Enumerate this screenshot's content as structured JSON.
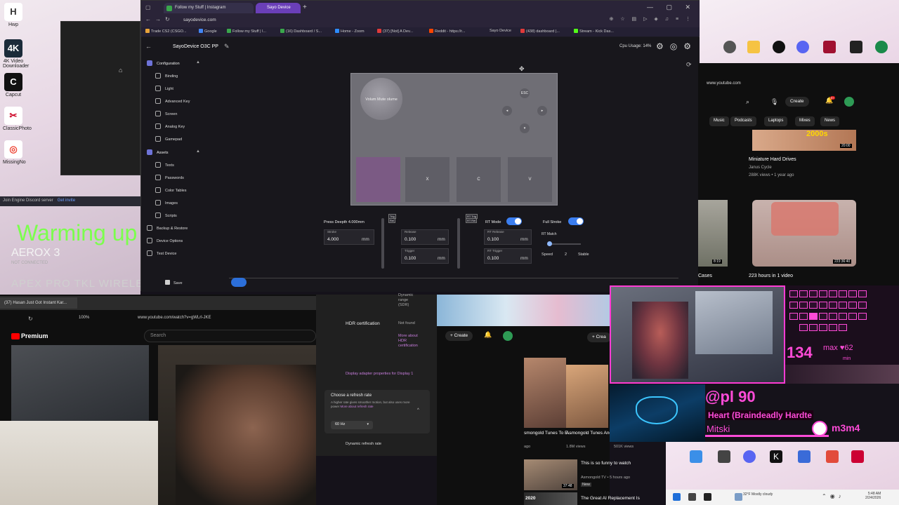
{
  "desktop_left": {
    "icons": [
      {
        "label": "Hwp",
        "glyph": "H"
      },
      {
        "label": "4K Video Downloader",
        "glyph": "4K"
      },
      {
        "label": "Capcut",
        "glyph": "C"
      },
      {
        "label": "ClassicPhoto",
        "glyph": "✂"
      },
      {
        "label": "MissingNo",
        "glyph": "◎"
      }
    ],
    "join_text": "Join Engine Discord server",
    "join_link": "Get invite",
    "overlay_status": "Warming up >_<",
    "device_name": "AEROX 3",
    "device_status": "NOT CONNECTED",
    "device_name_2": "APEX PRO TKL WIRELE"
  },
  "chrome": {
    "tabs": [
      {
        "label": "Follow my Stuff | Instagram"
      },
      {
        "label": "Sayo Device"
      }
    ],
    "url": "sayodevice.com",
    "bookmarks": [
      "Trade CS2 (CSGO...",
      "Google",
      "Follow my Stuff | I...",
      "(16) Dashboard / S...",
      "Home - Zoom",
      "(37) [Not] A Dev...",
      "Reddit - https://r...",
      "Sayo Device",
      "(438) dashboard |...",
      "Stream - Kick Das..."
    ]
  },
  "app": {
    "title": "SayoDevice O3C PP",
    "cpu_usage": "Cpu Usage: 14%",
    "configuration_label": "Configuration",
    "config_items": [
      "Binding",
      "Light",
      "Advanced Key",
      "Screen",
      "Analog Key",
      "Gamepad"
    ],
    "assets_label": "Assets",
    "asset_items": [
      "Texts",
      "Passwords",
      "Color Tables",
      "Images",
      "Scripts"
    ],
    "extra_items": [
      "Backup & Restore",
      "Device Options",
      "Test Device"
    ],
    "save_label": "Save",
    "knob_label": "Volum Mute olume",
    "circle_keys": [
      "ESC",
      "",
      "",
      ""
    ],
    "keys": [
      "",
      "X",
      "C",
      "V"
    ],
    "press_depth_label": "Press Deepth 4.000mm",
    "stroke_label": "Stroke",
    "stroke_value": "4.000",
    "unit": "mm",
    "release_label": "Release",
    "release_value": "0.100",
    "trigger_label": "Trigger",
    "trigger_value": "0.100",
    "rt_release_label": "RT Release",
    "rt_release_value": "0.100",
    "rt_trigger_label": "RT Trigger",
    "rt_trigger_value": "0.100",
    "rt_mode_label": "RT Mode",
    "full_stroke_label": "Full Stroke",
    "rt_match_label": "RT Match",
    "speed_label": "Speed",
    "speed_value": "2",
    "stable_label": "Stable",
    "tag_trig": "Trig",
    "tag_rt_trig": "RT Trig",
    "tag_rt_rel": "RT Rel",
    "tag_rel": "Rel"
  },
  "yt_right": {
    "url": "www.youtube.com",
    "create": "Create",
    "badge": "9+",
    "chips": [
      "Music",
      "Podcasts",
      "Laptops",
      "Mixes",
      "News"
    ],
    "thumb1_text": "2000s",
    "thumb1_duration": "20:00",
    "video1_title": "Miniature Hard Drives",
    "video1_channel": "Janus Cycle",
    "video1_meta": "288K views • 1 year ago",
    "thumb2_duration": "223:36:40",
    "video2_title": "223 hours in 1 video",
    "cases_label": "Cases",
    "left_thumb_duration": "8:19"
  },
  "yt_bottom": {
    "tab_label": "(37) Hasan Just Got Instant Kar...",
    "zoom": "100%",
    "url": "www.youtube.com/watch?v=gWLrl-JKE",
    "brand": "Premium",
    "search_placeholder": "Search"
  },
  "settings": {
    "top_text": "Dynamic range (SDR)",
    "hdr_label": "HDR certification",
    "hdr_value": "Not found",
    "hdr_more": "More about HDR certification",
    "adapter_link": "Display adapter properties for Display 1",
    "refresh_title": "Choose a refresh rate",
    "refresh_desc": "A higher rate gives smoother motion, but also uses more power",
    "refresh_link": "More about refresh rate",
    "hz": "60 Hz",
    "dynamic": "Dynamic refresh rate"
  },
  "yt_mid": {
    "create": "Create",
    "create2": "Crea",
    "videos": [
      {
        "title": "smongold Tunes To E...",
        "meta": "ago"
      },
      {
        "title": "Asmongold Tunes And His ...",
        "meta": "1.8M views"
      },
      {
        "title": "This is so funny to watch",
        "meta": "Asmongold TV • 5 hours ago",
        "duration": "37:48",
        "extra": "New"
      },
      {
        "title": "The Great AI Replacement Is",
        "meta": "",
        "year": "2020"
      }
    ],
    "views_extra": "501K views"
  },
  "stream": {
    "speed": "134",
    "max_label": "max",
    "max_value": "62",
    "min_label": "min",
    "handle": "@pl 90",
    "song": "Heart (Braindeadly Hardte",
    "artist": "Mitski",
    "user": "m3m4"
  },
  "taskbar": {
    "weather": "32°F Mostly cloudy",
    "time": "5:48 AM",
    "date": "2/24/2026"
  }
}
